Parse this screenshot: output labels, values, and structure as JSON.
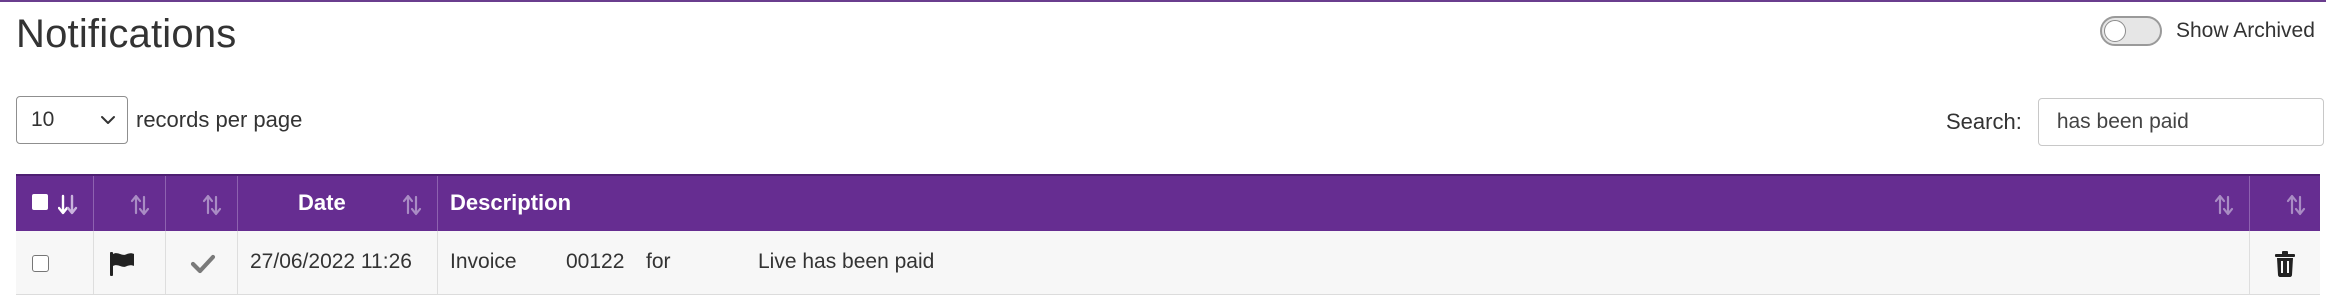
{
  "header": {
    "title": "Notifications"
  },
  "archived_toggle": {
    "label": "Show Archived",
    "checked": false
  },
  "length_menu": {
    "selected": "10",
    "label": "records per page"
  },
  "search": {
    "label": "Search:",
    "value": "has been paid"
  },
  "table": {
    "columns": [
      {
        "key": "select",
        "label": ""
      },
      {
        "key": "flag",
        "label": ""
      },
      {
        "key": "status",
        "label": ""
      },
      {
        "key": "date",
        "label": "Date"
      },
      {
        "key": "description",
        "label": "Description"
      },
      {
        "key": "actions",
        "label": ""
      }
    ],
    "rows": [
      {
        "checked": false,
        "flag_icon": "flag-icon",
        "status_icon": "check-icon",
        "date": "27/06/2022 11:26",
        "description": {
          "part1": "Invoice",
          "part2": "00122",
          "part3": "for",
          "part4": "Live has been paid"
        },
        "action_icon": "trash-icon"
      }
    ]
  },
  "colors": {
    "header_bg": "#662d91",
    "header_text": "#ffffff",
    "row_bg": "#f7f7f7",
    "text": "#333333"
  }
}
